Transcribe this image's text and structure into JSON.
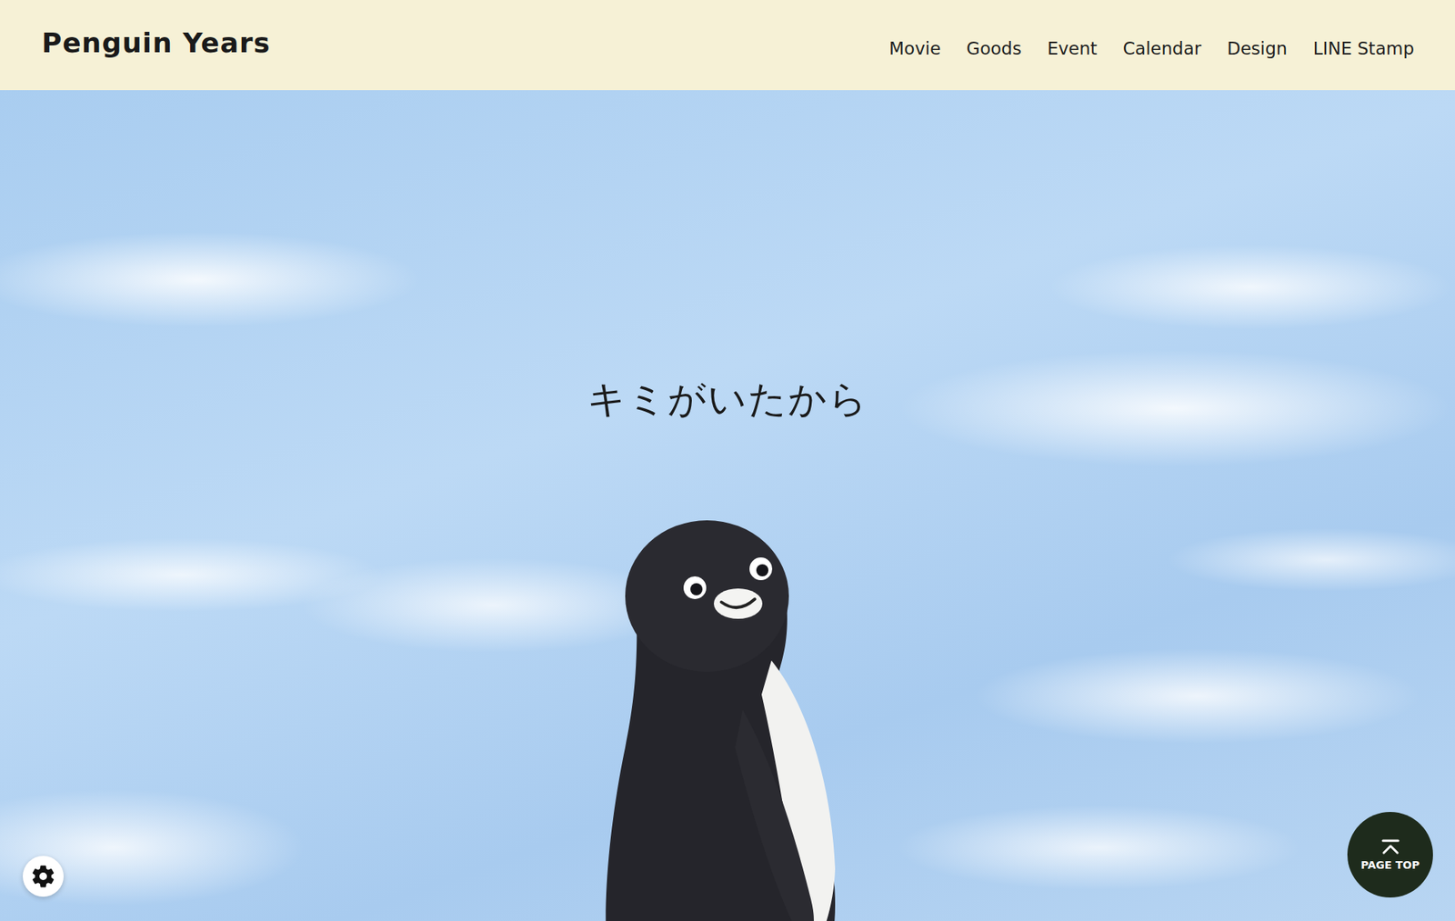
{
  "header": {
    "logo": "Penguin Years",
    "nav": [
      {
        "label": "Movie"
      },
      {
        "label": "Goods"
      },
      {
        "label": "Event"
      },
      {
        "label": "Calendar"
      },
      {
        "label": "Design"
      },
      {
        "label": "LINE Stamp"
      }
    ]
  },
  "hero": {
    "heading": "キミがいたから"
  },
  "page_top": {
    "label": "PAGE TOP"
  }
}
